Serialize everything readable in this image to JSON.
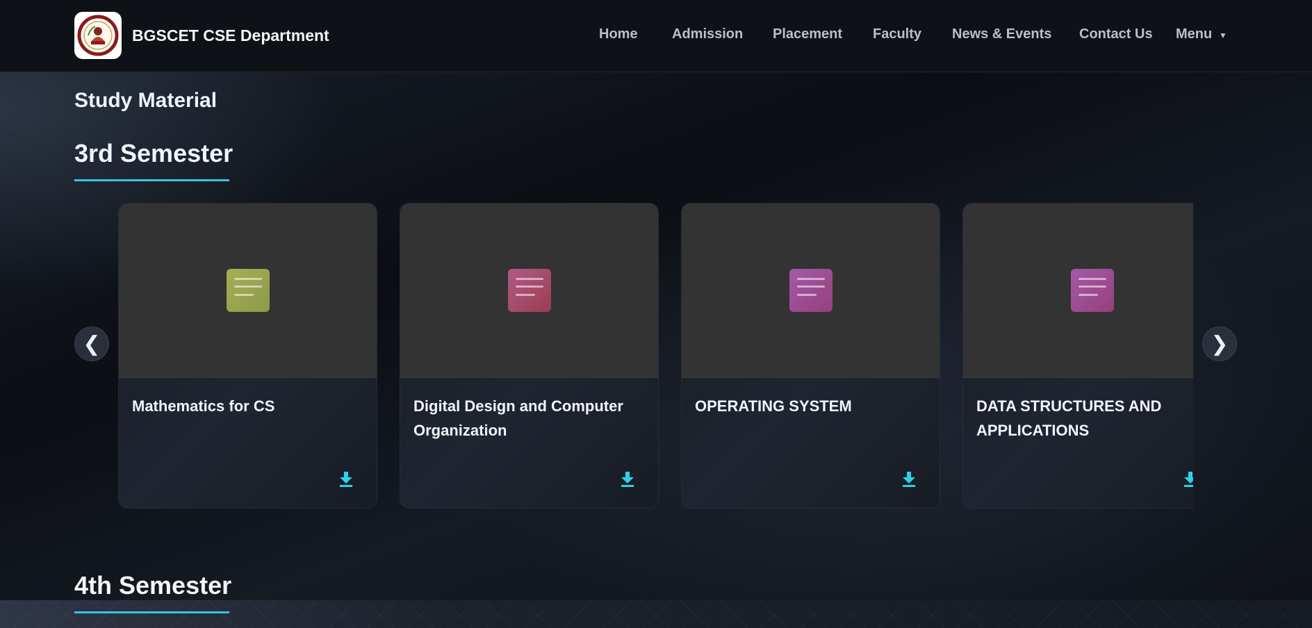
{
  "header": {
    "brand_title": "BGSCET CSE Department",
    "logo_icon": "college-emblem-icon",
    "nav": [
      {
        "label": "Home"
      },
      {
        "label": "Admission"
      },
      {
        "label": "Placement"
      },
      {
        "label": "Faculty"
      },
      {
        "label": "News & Events"
      },
      {
        "label": "Contact Us"
      },
      {
        "label": "Menu",
        "icon": "caret-down-icon"
      }
    ]
  },
  "main": {
    "page_title": "Study Material",
    "semesters": [
      {
        "heading": "3rd Semester",
        "carousel": {
          "prev_label": "❮",
          "next_label": "❯",
          "cards": [
            {
              "title": "Mathematics for CS",
              "icon": "document-icon",
              "icon_color": "#9aa34e",
              "action_icon": "download-icon"
            },
            {
              "title": "Digital Design and Computer Organization",
              "icon": "document-icon",
              "icon_color": "#a64b6b",
              "action_icon": "download-icon"
            },
            {
              "title": "OPERATING SYSTEM",
              "icon": "document-icon",
              "icon_color": "#9c4e94",
              "action_icon": "download-icon"
            },
            {
              "title": "DATA STRUCTURES AND APPLICATIONS",
              "icon": "document-icon",
              "icon_color": "#9c4e94",
              "action_icon": "download-icon"
            }
          ]
        }
      },
      {
        "heading": "4th Semester"
      }
    ]
  },
  "colors": {
    "accent": "#36c6e0",
    "background": "#0c0f14",
    "navbar": "#0e1116",
    "card_thumb": "#333333"
  }
}
